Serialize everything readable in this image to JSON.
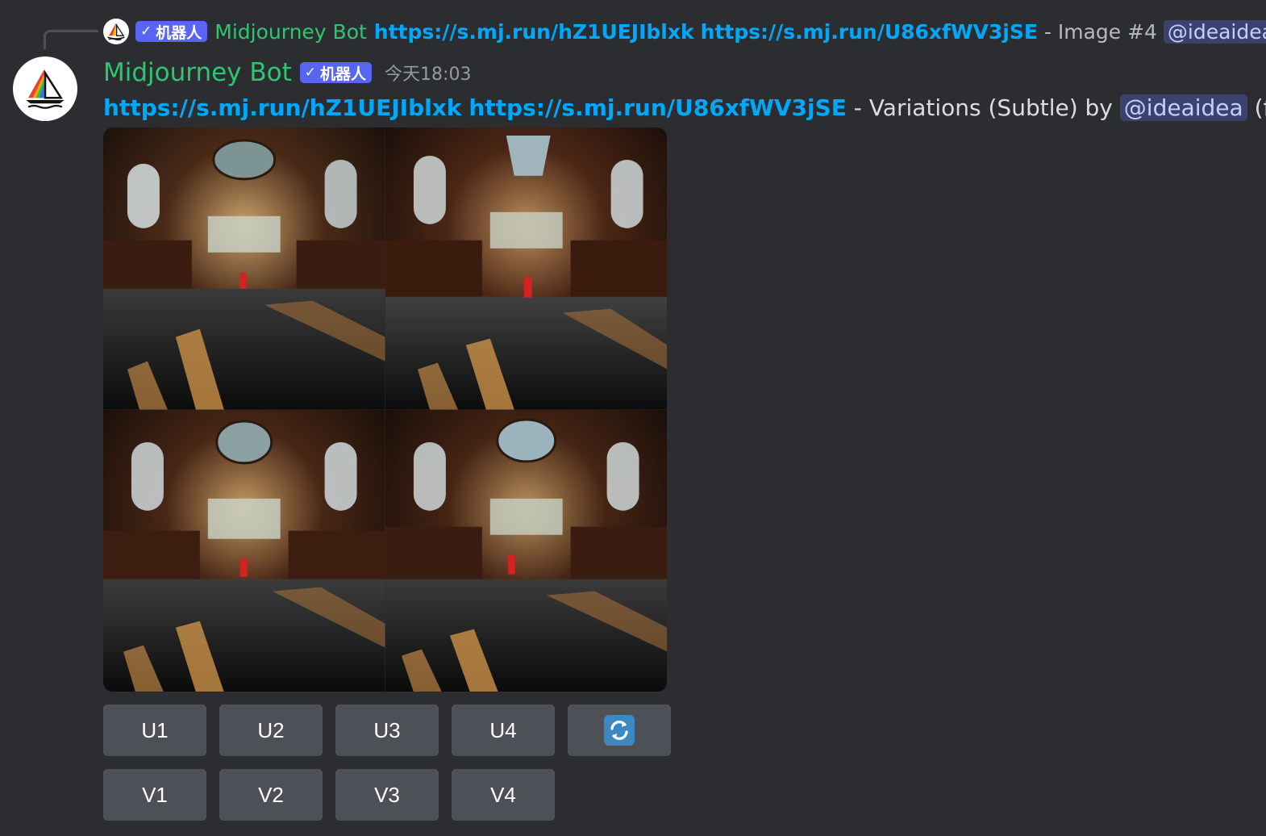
{
  "reply": {
    "author": "Midjourney Bot",
    "badge": "机器人",
    "links": [
      "https://s.mj.run/hZ1UEJIblxk",
      "https://s.mj.run/U86xfWV3jSE"
    ],
    "suffix": "- Image #4",
    "mention": "@ideaidea"
  },
  "message": {
    "author": "Midjourney Bot",
    "badge": "机器人",
    "timestamp": "今天18:03",
    "links": [
      "https://s.mj.run/hZ1UEJIblxk",
      "https://s.mj.run/U86xfWV3jSE"
    ],
    "text": "- Variations (Subtle) by",
    "mention": "@ideaidea",
    "trailing": "(fast)"
  },
  "image_grid": {
    "tiles": [
      "library-variation-1",
      "library-variation-2",
      "library-variation-3",
      "library-variation-4"
    ]
  },
  "buttons": {
    "upscale": [
      "U1",
      "U2",
      "U3",
      "U4"
    ],
    "variation": [
      "V1",
      "V2",
      "V3",
      "V4"
    ],
    "reroll_icon": "refresh-icon"
  },
  "colors": {
    "background": "#2b2d31",
    "author": "#2dc770",
    "link": "#00a8fc",
    "badge": "#5865f2",
    "button": "#4e5058",
    "mention_bg": "#3c4270"
  }
}
